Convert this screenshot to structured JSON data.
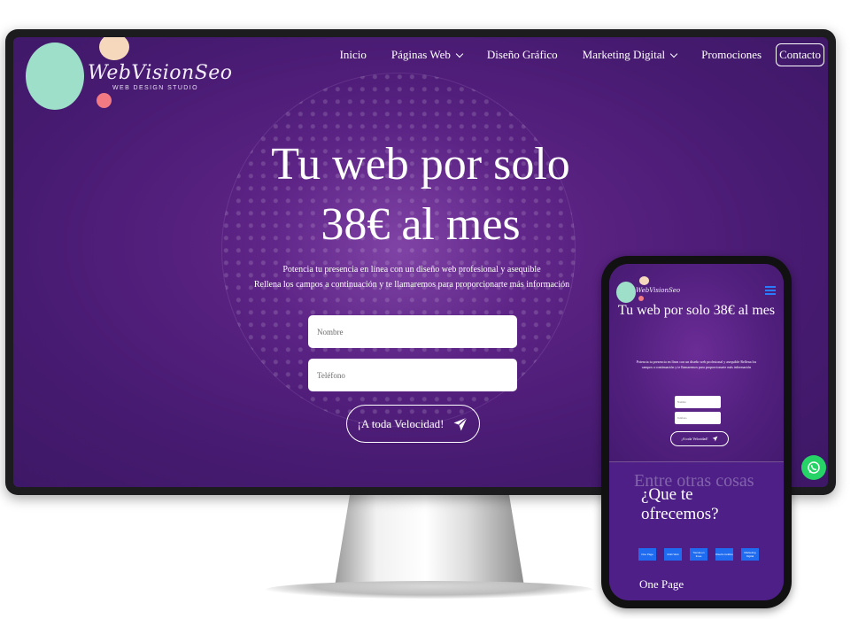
{
  "brand": {
    "logo_text": "WebVisionSeo",
    "logo_subtitle": "WEB DESIGN STUDIO",
    "colors": {
      "mint": "#9edfc9",
      "peach": "#f6d9bc",
      "coral": "#f17a83",
      "purple": "#55207e",
      "accent_blue": "#1f6cf0",
      "whatsapp": "#25d366"
    }
  },
  "nav": {
    "items": [
      {
        "label": "Inicio"
      },
      {
        "label": "Páginas Web",
        "dropdown": true
      },
      {
        "label": "Diseño Gráfico"
      },
      {
        "label": "Marketing Digital",
        "dropdown": true
      },
      {
        "label": "Promociones"
      }
    ],
    "contact_label": "Contacto"
  },
  "hero": {
    "title_line1": "Tu web por solo",
    "title_line2": "38€ al mes",
    "subtitle_line1": "Potencia tu presencia en línea con un diseño web profesional y asequible",
    "subtitle_line2": "Rellena los campos a continuación y te llamaremos para proporcionarte más información",
    "name_placeholder": "Nombre",
    "phone_placeholder": "Teléfono",
    "cta_label": "¡A toda Velocidad!",
    "cta_icon": "paper-plane-icon"
  },
  "mobile": {
    "title": "Tu web por solo 38€ al mes",
    "subtitle": "Potencia tu presencia en línea con un diseño web profesional y asequible Rellena los campos a continuación y te llamaremos para proporcionarte más información",
    "name_placeholder": "Nombre",
    "phone_placeholder": "Teléfono",
    "cta_label": "¡A toda Velocidad!",
    "ghost_text": "Entre otras cosas",
    "section_heading": "¿Que te ofrecemos?",
    "chips": [
      "One Page",
      "Multi Web",
      "Tienda en línea",
      "Diseño Gráfico",
      "Marketing Digital"
    ],
    "section_title": "One Page"
  },
  "icons": {
    "menu": "hamburger-icon",
    "whatsapp": "whatsapp-icon",
    "dropdown": "chevron-down-icon"
  }
}
